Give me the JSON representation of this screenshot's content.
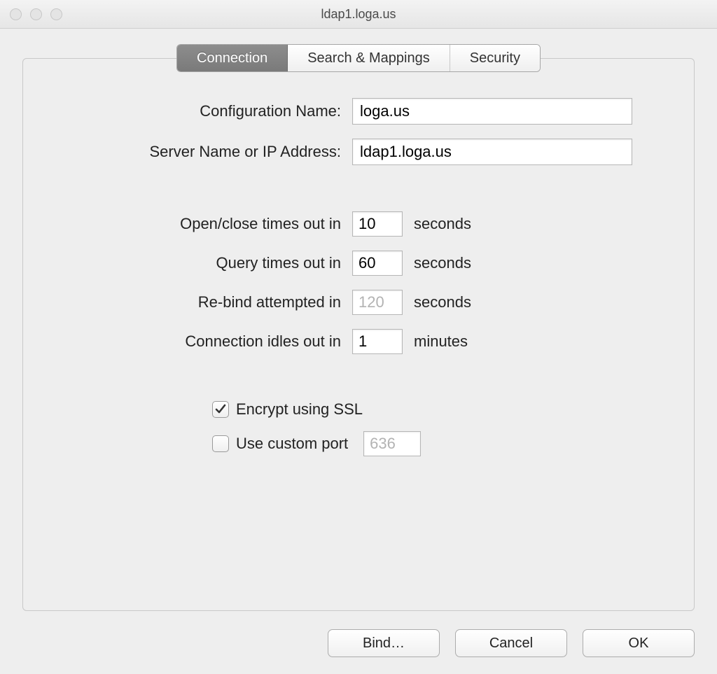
{
  "window": {
    "title": "ldap1.loga.us"
  },
  "tabs": {
    "connection": "Connection",
    "search_mappings": "Search & Mappings",
    "security": "Security"
  },
  "form": {
    "config_name_label": "Configuration Name:",
    "config_name_value": "loga.us",
    "server_label": "Server Name or IP Address:",
    "server_value": "ldap1.loga.us",
    "open_close_label": "Open/close times out in",
    "open_close_value": "10",
    "open_close_unit": "seconds",
    "query_label": "Query times out in",
    "query_value": "60",
    "query_unit": "seconds",
    "rebind_label": "Re-bind attempted in",
    "rebind_value": "120",
    "rebind_unit": "seconds",
    "idle_label": "Connection idles out in",
    "idle_value": "1",
    "idle_unit": "minutes",
    "ssl_label": "Encrypt using SSL",
    "custom_port_label": "Use custom port",
    "custom_port_value": "636"
  },
  "buttons": {
    "bind": "Bind…",
    "cancel": "Cancel",
    "ok": "OK"
  }
}
